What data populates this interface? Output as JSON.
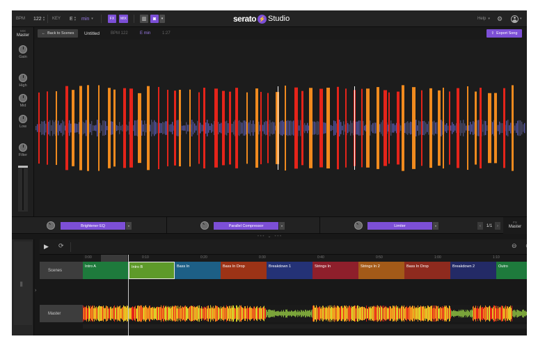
{
  "topbar": {
    "bpm_label": "BPM",
    "bpm_value": "122",
    "key_label": "KEY",
    "key_value": "E",
    "key_mode": "min",
    "fx_label": "FX",
    "mix_label": "MIX",
    "logo_word": "serato",
    "logo_product": "Studio",
    "help_label": "Help"
  },
  "mixer": {
    "mix_label": "MIX",
    "channel": "Master",
    "knobs": [
      "Gain",
      "High",
      "Mid",
      "Low",
      "Filter"
    ]
  },
  "songbar": {
    "back_label": "Back to Scenes",
    "title": "Untitled",
    "bpm": "BPM 122",
    "key": "E min",
    "length": "1:27",
    "export_label": "Export Song"
  },
  "fx": {
    "slots": [
      "Brightener EQ",
      "Parallel Compressor",
      "Limiter"
    ],
    "page": "1/1",
    "master_fx_label": "FX",
    "master_label": "Master"
  },
  "arrange": {
    "ruler": [
      "0:00",
      "0:10",
      "0:20",
      "0:30",
      "0:40",
      "0:50",
      "1:00",
      "1:10"
    ],
    "scenes_label": "Scenes",
    "master_label": "Master",
    "scenes": [
      {
        "name": "Intro A",
        "color": "#1e7a3c"
      },
      {
        "name": "Intro B",
        "color": "#5e9a2a"
      },
      {
        "name": "Bass In",
        "color": "#1d5f86"
      },
      {
        "name": "Bass In Drop",
        "color": "#9c3316"
      },
      {
        "name": "Breakdown 1",
        "color": "#243276"
      },
      {
        "name": "Strings In",
        "color": "#8e1f2b"
      },
      {
        "name": "Strings In 2",
        "color": "#a35a18"
      },
      {
        "name": "Bass In Drop",
        "color": "#8e2a1e"
      },
      {
        "name": "Breakdown 2",
        "color": "#232a66"
      },
      {
        "name": "Outro",
        "color": "#1e7a3c"
      }
    ]
  },
  "colors": {
    "accent": "#7c4fd6",
    "wave_red": "#e5241a",
    "wave_orange": "#f08a1e",
    "wave_blue": "#5656a6"
  }
}
